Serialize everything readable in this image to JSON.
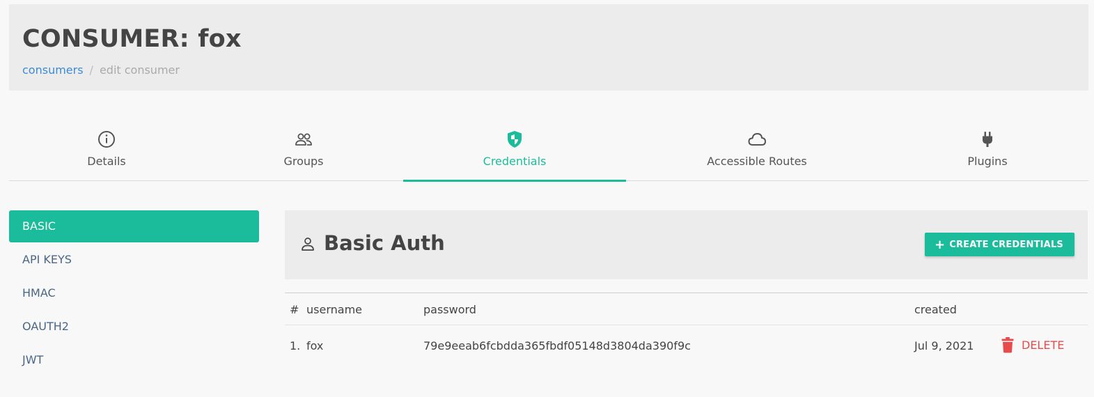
{
  "header": {
    "title": "CONSUMER: fox",
    "breadcrumb": {
      "link": "consumers",
      "separator": "/",
      "current": "edit consumer"
    }
  },
  "tabs": [
    {
      "label": "Details",
      "icon": "info-icon"
    },
    {
      "label": "Groups",
      "icon": "users-icon"
    },
    {
      "label": "Credentials",
      "icon": "shield-icon",
      "active": true
    },
    {
      "label": "Accessible Routes",
      "icon": "cloud-icon"
    },
    {
      "label": "Plugins",
      "icon": "plug-icon"
    }
  ],
  "sidebar": {
    "items": [
      {
        "label": "BASIC",
        "active": true
      },
      {
        "label": "API KEYS"
      },
      {
        "label": "HMAC"
      },
      {
        "label": "OAUTH2"
      },
      {
        "label": "JWT"
      }
    ]
  },
  "panel": {
    "title": "Basic Auth",
    "icon": "user-icon",
    "create_button": "CREATE CREDENTIALS"
  },
  "table": {
    "columns": [
      "#",
      "username",
      "password",
      "created"
    ],
    "rows": [
      {
        "num": "1.",
        "username": "fox",
        "password": "79e9eeab6fcbdda365fbdf05148d3804da390f9c",
        "created": "Jul 9, 2021",
        "delete_label": "DELETE"
      }
    ]
  },
  "colors": {
    "accent": "#1bbc9b",
    "danger": "#e84b4b",
    "link": "#3d8bd1"
  }
}
